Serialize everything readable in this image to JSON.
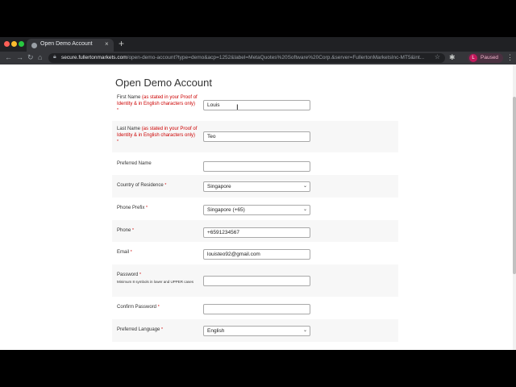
{
  "browser": {
    "tab_title": "Open Demo Account",
    "tab_close": "×",
    "new_tab": "+",
    "url_host": "secure.fullertonmarkets.com",
    "url_path": "/open-demo-account?type=demo&acp=1252&label=MetaQuotes%20Software%20Corp.&server=FullertonMarketsInc-MT5&int...",
    "profile_initial": "L",
    "profile_status": "Paused"
  },
  "form": {
    "title": "Open Demo Account",
    "first_name": {
      "label": "First Name",
      "note": "(as stated in your Proof of Identity & in English characters only)",
      "value": "Louis"
    },
    "last_name": {
      "label": "Last Name",
      "note": "(as stated in your Proof of Identity & in English characters only)",
      "value": "Teo"
    },
    "preferred_name": {
      "label": "Preferred Name",
      "value": ""
    },
    "country": {
      "label": "Country of Residence",
      "value": "Singapore"
    },
    "phone_prefix": {
      "label": "Phone Prefix",
      "value": "Singapore (+65)"
    },
    "phone": {
      "label": "Phone",
      "value": "+6591234567"
    },
    "email": {
      "label": "Email",
      "value": "louisteo92@gmail.com"
    },
    "password": {
      "label": "Password",
      "hint": "Minimum 8 symbols in lower and UPPER cases",
      "value": ""
    },
    "confirm_password": {
      "label": "Confirm Password",
      "value": ""
    },
    "language": {
      "label": "Preferred Language",
      "value": "English"
    },
    "required_mark": "*"
  }
}
